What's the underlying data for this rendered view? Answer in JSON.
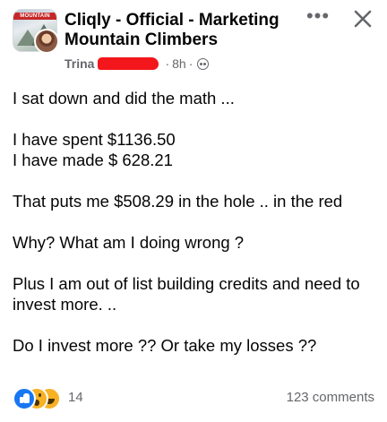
{
  "post": {
    "group_avatar_text": "MOUNTAIN",
    "title": "Cliqly - Official - Marketing Mountain Climbers",
    "author": "Trina",
    "time": "8h",
    "separator": "·",
    "more_label": "•••",
    "icons": {
      "more": "more-dots-icon",
      "close": "close-icon",
      "privacy": "globe-icon"
    },
    "body": {
      "p1": "I sat down and did the math ...",
      "p2_line1": "I have spent $1136.50",
      "p2_line2": "I have made $ 628.21",
      "p3": "That puts me $508.29 in the hole .. in the red",
      "p4": "Why? What am I doing wrong ?",
      "p5": "Plus I am out of list building credits and need to invest more. ..",
      "p6": "Do I invest more ?? Or take my losses ??"
    }
  },
  "footer": {
    "reaction_types": [
      "like",
      "wow",
      "haha"
    ],
    "reaction_count": "14",
    "comments": "123 comments"
  },
  "colors": {
    "like": "#1877f2",
    "emoji": "#f7b125",
    "meta_text": "#65676b",
    "redaction": "#f3161b"
  }
}
